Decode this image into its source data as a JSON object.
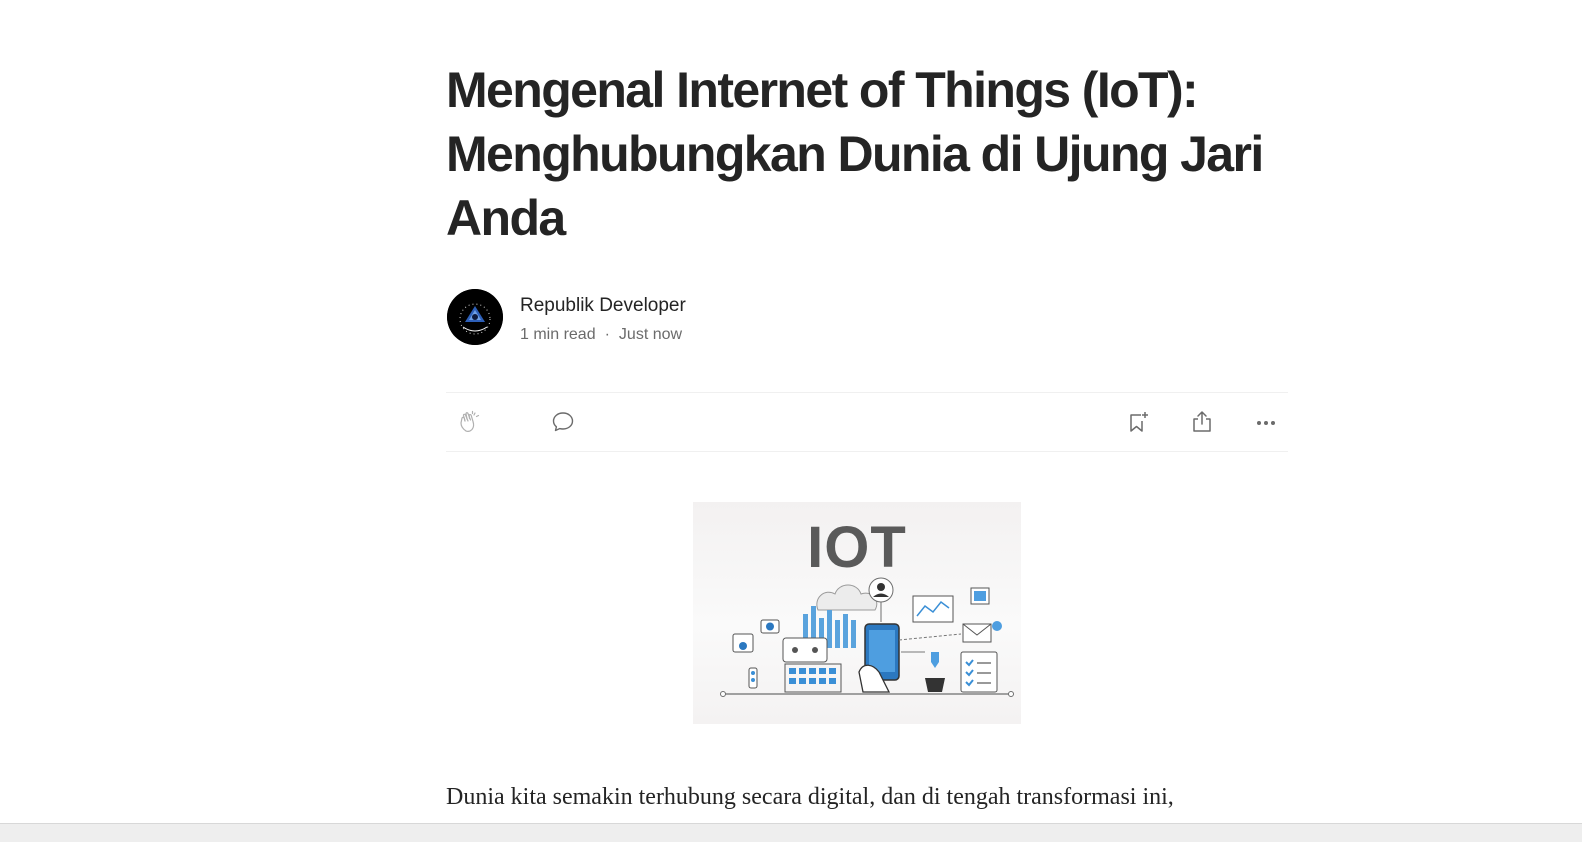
{
  "article": {
    "title": "Mengenal Internet of Things (IoT): Menghubungkan Dunia di Ujung Jari Anda",
    "author": "Republik Developer",
    "read_time": "1 min read",
    "separator": "·",
    "published": "Just now",
    "body_first_line": "Dunia kita semakin terhubung secara digital, dan di tengah transformasi ini,"
  },
  "figure": {
    "label": "IOT"
  },
  "actions": {
    "clap_icon": "clap-icon",
    "comment_icon": "comment-icon",
    "bookmark_icon": "bookmark-add-icon",
    "share_icon": "share-icon",
    "more_icon": "more-icon"
  },
  "colors": {
    "text": "#242424",
    "muted": "#6b6b6b",
    "accent_blue": "#3a8fd6"
  }
}
